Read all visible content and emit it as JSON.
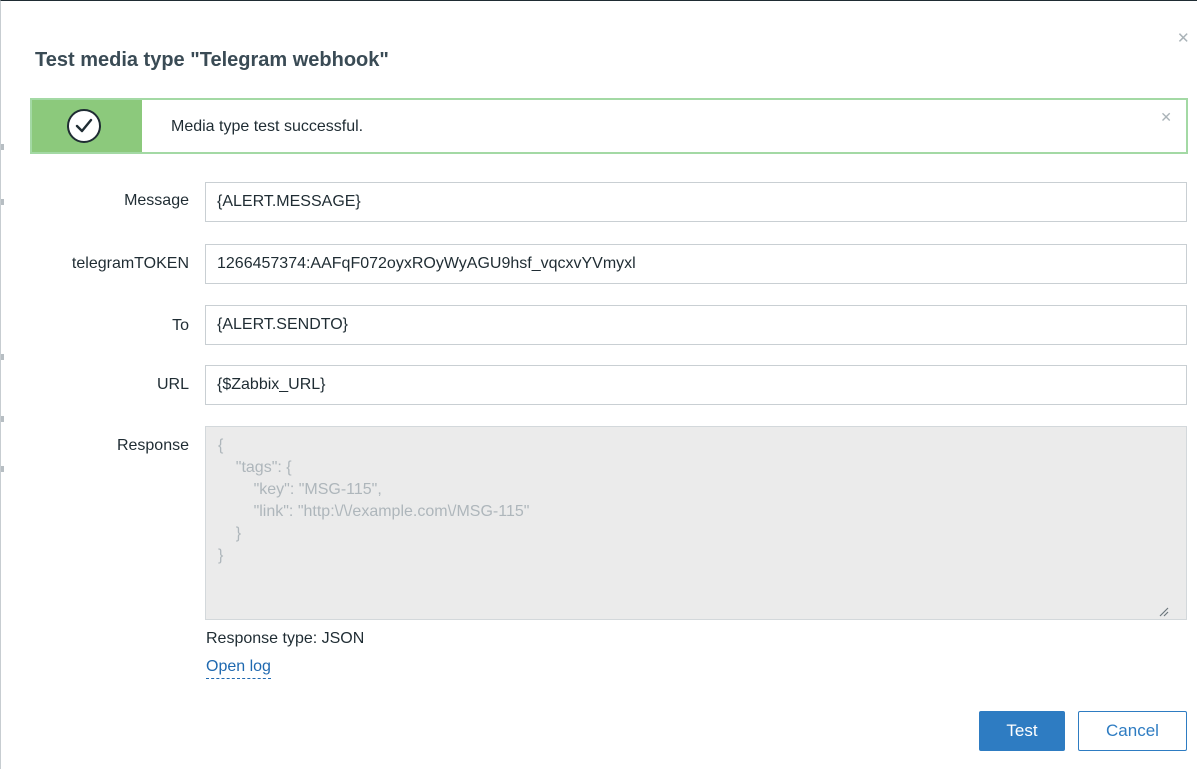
{
  "dialog": {
    "title": "Test media type \"Telegram webhook\"",
    "close_glyph": "✕"
  },
  "message": {
    "text": "Media type test successful.",
    "icon": "check-circle-icon",
    "close_glyph": "✕",
    "accent_color": "#8cc97c"
  },
  "form": {
    "fields": [
      {
        "label": "Message",
        "value": "{ALERT.MESSAGE}"
      },
      {
        "label": "telegramTOKEN",
        "value": "1266457374:AAFqF072oyxROyWyAGU9hsf_vqcxvYVmyxl"
      },
      {
        "label": "To",
        "value": "{ALERT.SENDTO}"
      },
      {
        "label": "URL",
        "value": "{$Zabbix_URL}"
      }
    ],
    "response": {
      "label": "Response",
      "value": "{\n    \"tags\": {\n        \"key\": \"MSG-115\",\n        \"link\": \"http:\\/\\/example.com\\/MSG-115\"\n    }\n}"
    },
    "response_type": "Response type: JSON",
    "open_log": "Open log"
  },
  "buttons": {
    "test": "Test",
    "cancel": "Cancel"
  },
  "colors": {
    "primary": "#2e7cc2",
    "success_border": "#a3d9a4"
  }
}
